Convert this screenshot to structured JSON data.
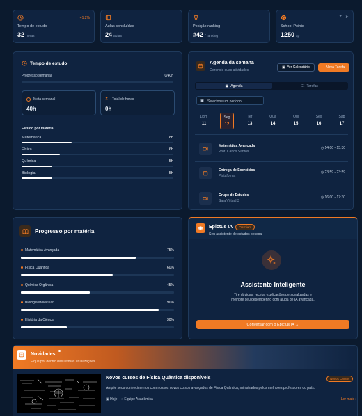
{
  "stats": [
    {
      "label": "Tempo de estudo",
      "value": "32",
      "unit": "horas",
      "delta": "+1.2%",
      "icon": "clock-icon"
    },
    {
      "label": "Aulas concluídas",
      "value": "24",
      "unit": "aulas",
      "delta": "",
      "icon": "book-icon"
    },
    {
      "label": "Posição ranking",
      "value": "#42",
      "unit": "/ ranking",
      "delta": "",
      "icon": "trophy-icon"
    },
    {
      "label": "School Points",
      "value": "1250",
      "unit": "sp",
      "delta": "",
      "icon": "coin-icon"
    }
  ],
  "study": {
    "title": "Tempo de estudo",
    "weekly_label": "Progresso semanal",
    "weekly_value": "0/40h",
    "weekly_progress": 0,
    "goal_label": "Meta semanal",
    "goal_value": "40h",
    "total_label": "Total de horas",
    "total_value": "0h",
    "by_subject_label": "Estudo por matéria",
    "subjects": [
      {
        "name": "Matemática",
        "hours": "8h",
        "progress": 0.33
      },
      {
        "name": "Física",
        "hours": "6h",
        "progress": 0.25
      },
      {
        "name": "Química",
        "hours": "5h",
        "progress": 0.2
      },
      {
        "name": "Biologia",
        "hours": "5h",
        "progress": 0.2
      }
    ]
  },
  "agenda": {
    "title": "Agenda da semana",
    "subtitle": "Gerencie suas atividades",
    "calendar_button": "Ver Calendário",
    "new_task_button": "+ Nova Tarefa",
    "tab_agenda": "Agenda",
    "tab_tasks": "Tarefas",
    "period_placeholder": "Selecione um período",
    "days": [
      {
        "d": "Dom",
        "n": "11"
      },
      {
        "d": "Seg",
        "n": "12"
      },
      {
        "d": "Ter",
        "n": "13"
      },
      {
        "d": "Qua",
        "n": "14"
      },
      {
        "d": "Qui",
        "n": "15"
      },
      {
        "d": "Sex",
        "n": "16"
      },
      {
        "d": "Sáb",
        "n": "17"
      }
    ],
    "events": [
      {
        "title": "Matemática Avançada",
        "sub": "Prof. Carlos Santos",
        "time": "14:00 - 15:30"
      },
      {
        "title": "Entrega de Exercícios",
        "sub": "Plataforma",
        "time": "23:59 - 23:59"
      },
      {
        "title": "Grupo de Estudos",
        "sub": "Sala Virtual 3",
        "time": "16:00 - 17:30"
      }
    ]
  },
  "progress": {
    "title": "Progresso por matéria",
    "items": [
      {
        "name": "Matemática Avançada",
        "pct": "75%",
        "progress": 0.75
      },
      {
        "name": "Física Quântica",
        "pct": "60%",
        "progress": 0.6
      },
      {
        "name": "Química Orgânica",
        "pct": "45%",
        "progress": 0.45
      },
      {
        "name": "Biologia Molecular",
        "pct": "90%",
        "progress": 0.9
      },
      {
        "name": "História da Ciência",
        "pct": "30%",
        "progress": 0.3
      }
    ]
  },
  "ai": {
    "title": "Epictus IA",
    "badge": "Premium",
    "subtitle": "Seu assistente de estudos pessoal",
    "heading": "Assistente Inteligente",
    "description": "Tire dúvidas, receba explicações personalizadas e melhore seu desempenho com ajuda de IA avançada.",
    "button": "Conversar com o Epictus IA  →"
  },
  "news": {
    "title": "Novidades",
    "subtitle": "Fique por dentro das últimas atualizações",
    "item_title": "Novos cursos de Física Quântica disponíveis",
    "item_badge": "Novos Cursos",
    "item_text": "Amplie seus conhecimentos com nossos novos cursos avançados de Física Quântica, ministrados pelos melhores professores do país.",
    "item_date": "Hoje",
    "item_author": "Equipe Acadêmica",
    "read_more": "Ler mais  ›"
  },
  "colors": {
    "accent": "#f07a24",
    "bg": "#0b1a2e",
    "card": "#0f2340"
  }
}
